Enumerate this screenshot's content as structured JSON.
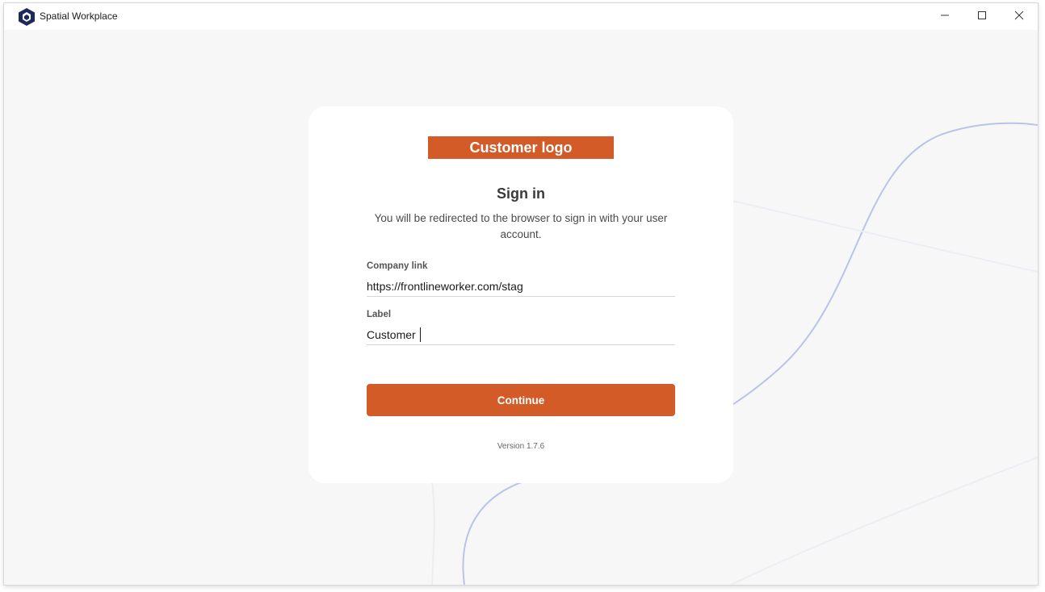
{
  "window": {
    "title": "Spatial Workplace"
  },
  "card": {
    "logo_text": "Customer logo",
    "title": "Sign in",
    "description": "You will be redirected to the browser to sign in with your user account.",
    "company_link": {
      "label": "Company link",
      "value": "https://frontlineworker.com/stag"
    },
    "label_field": {
      "label": "Label",
      "value": "Customer"
    },
    "continue_label": "Continue",
    "version": "Version 1.7.6"
  },
  "icons": {
    "app": "app-logo-icon",
    "minimize": "minimize-icon",
    "maximize": "maximize-icon",
    "close": "close-icon"
  },
  "colors": {
    "accent": "#d35b28",
    "background": "#f7f7f8",
    "card": "#ffffff",
    "curve": "#b9c4e6",
    "app_icon": "#1f2a5c"
  }
}
